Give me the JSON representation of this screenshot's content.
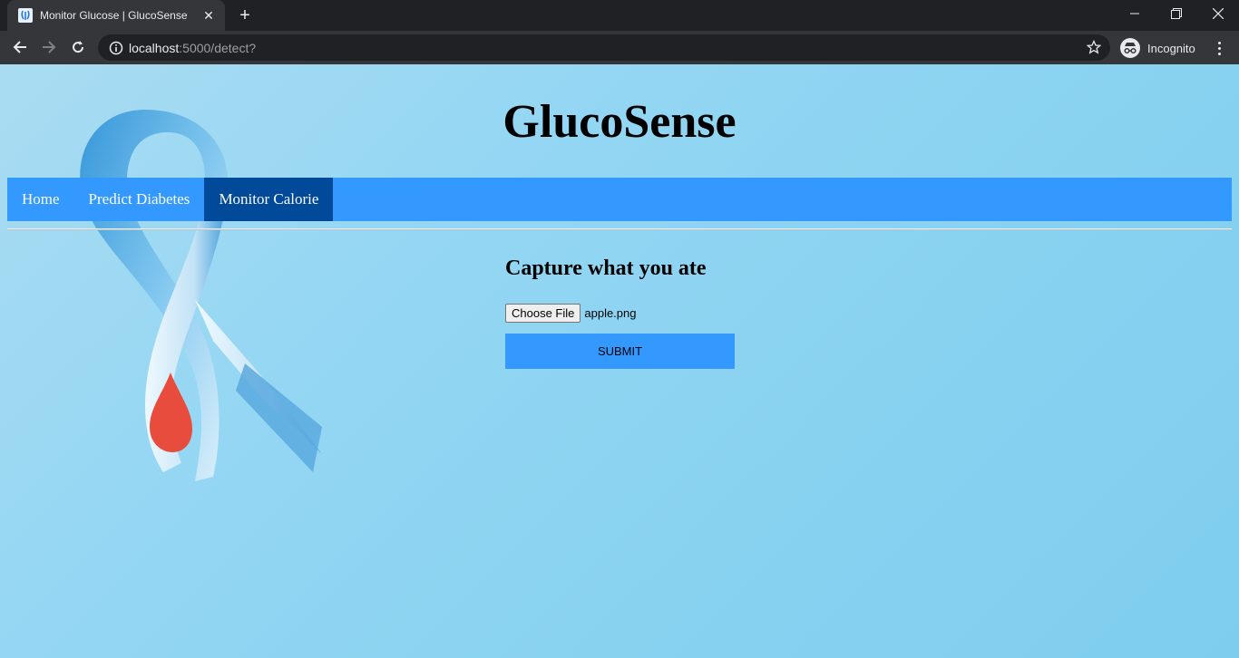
{
  "browser": {
    "tab_title": "Monitor Glucose | GlucoSense",
    "url_host": "localhost",
    "url_path": ":5000/detect?",
    "profile_label": "Incognito"
  },
  "site": {
    "title": "GlucoSense",
    "nav": [
      {
        "label": "Home"
      },
      {
        "label": "Predict Diabetes"
      },
      {
        "label": "Monitor Calorie"
      }
    ],
    "active_nav": "Monitor Calorie"
  },
  "form": {
    "heading": "Capture what you ate",
    "choose_file_label": "Choose File",
    "file_name": "apple.png",
    "submit_label": "SUBMIT"
  },
  "colors": {
    "nav_bar": "#3399ff",
    "nav_active": "#004a99",
    "submit_button": "#3399ff",
    "page_background": "#93d6f3"
  }
}
